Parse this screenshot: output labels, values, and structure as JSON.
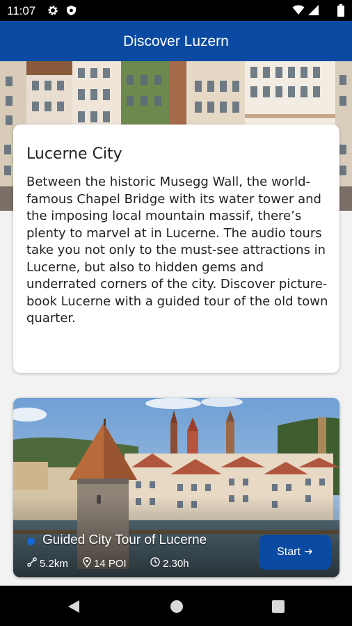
{
  "status": {
    "time": "11:07"
  },
  "appbar": {
    "title": "Discover Luzern"
  },
  "info_card": {
    "title": "Lucerne City",
    "body": "Between the historic Musegg Wall, the world-famous Chapel Bridge with its water tower and the imposing local mountain massif, there’s plenty to marvel at in Lucerne. The audio tours take you not only to the must-see attractions in Lucerne, but also to hidden gems and underrated corners of the city. Discover picture-book Lucerne with a guided tour of the old town quarter."
  },
  "tour": {
    "name": "Guided City Tour of Lucerne",
    "distance": "5.2km",
    "poi": "14 POI",
    "duration": "2.30h",
    "start_label": "Start"
  },
  "colors": {
    "primary": "#0a4aa3",
    "accent_dot": "#1565d8"
  },
  "icons": [
    "settings-icon",
    "shield-icon",
    "wifi-icon",
    "signal-icon",
    "battery-icon",
    "route-icon",
    "location-pin-icon",
    "clock-icon",
    "arrow-right-icon",
    "back-icon",
    "home-icon",
    "recents-icon"
  ]
}
